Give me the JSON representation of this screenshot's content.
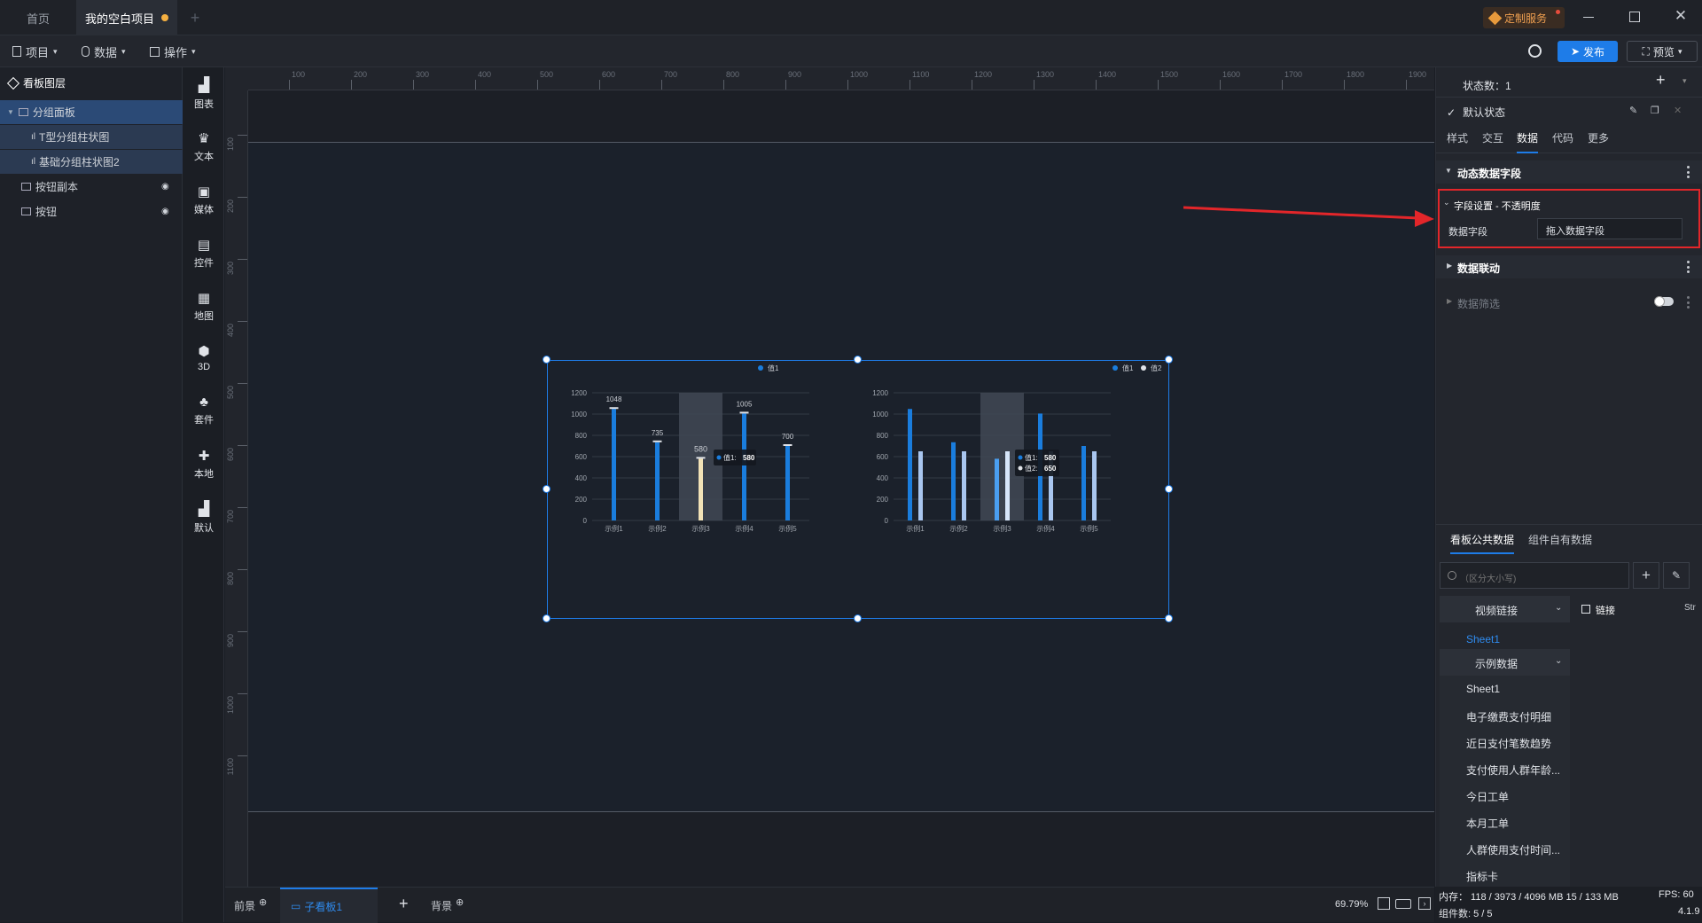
{
  "tabs": [
    {
      "label": "首页"
    },
    {
      "label": "我的空白项目"
    }
  ],
  "titlebar": {
    "custom_service": "定制服务"
  },
  "menubar": {
    "project": "项目",
    "data": "数据",
    "ops": "操作",
    "publish": "发布",
    "preview": "预览"
  },
  "layers": {
    "title": "看板图层",
    "items": [
      {
        "label": "分组面板"
      },
      {
        "label": "T型分组柱状图"
      },
      {
        "label": "基础分组柱状图2"
      },
      {
        "label": "按钮副本"
      },
      {
        "label": "按钮"
      }
    ]
  },
  "toolbox": [
    {
      "label": "图表",
      "icon": "chart-icon"
    },
    {
      "label": "文本",
      "icon": "text-icon"
    },
    {
      "label": "媒体",
      "icon": "media-icon"
    },
    {
      "label": "控件",
      "icon": "control-icon"
    },
    {
      "label": "地图",
      "icon": "map-icon"
    },
    {
      "label": "3D",
      "icon": "cube-icon"
    },
    {
      "label": "套件",
      "icon": "kit-icon"
    },
    {
      "label": "本地",
      "icon": "puzzle-icon"
    },
    {
      "label": "默认",
      "icon": "default-chart-icon"
    }
  ],
  "ruler": {
    "top_ticks": [
      "100",
      "200",
      "300",
      "400",
      "500",
      "600",
      "700",
      "800",
      "900",
      "1000",
      "1100",
      "1200",
      "1300",
      "1400",
      "1500",
      "1600",
      "1700",
      "1800",
      "1900"
    ],
    "left_ticks": [
      "100",
      "200",
      "300",
      "400",
      "500",
      "600",
      "700",
      "800",
      "900",
      "1000",
      "1100"
    ]
  },
  "bottom": {
    "foreground": "前景",
    "subboard": "子看板1",
    "background": "背景",
    "zoom": "69.79%"
  },
  "right": {
    "state_count_label": "状态数：1",
    "default_state": "默认状态",
    "tabs": [
      "样式",
      "交互",
      "数据",
      "代码",
      "更多"
    ],
    "dynamic_fields": "动态数据字段",
    "field_setting": "字段设置 - 不透明度",
    "data_field_label": "数据字段",
    "data_field_placeholder": "拖入数据字段",
    "data_link": "数据联动",
    "data_filter": "数据筛选",
    "data_tabs": [
      "看板公共数据",
      "组件自有数据"
    ],
    "search_placeholder": "（区分大小写)",
    "video_link": "视频链接",
    "link_label": "链接",
    "str_label": "Str",
    "sheet_active": "Sheet1",
    "example_data": "示例数据",
    "sheets": [
      "Sheet1",
      "电子缴费支付明细",
      "近日支付笔数趋势",
      "支付使用人群年龄...",
      "今日工单",
      "本月工单",
      "人群使用支付时间...",
      "指标卡"
    ]
  },
  "status": {
    "memory": "内存： 118 / 3973 / 4096 MB  15 / 133 MB",
    "fps": "FPS:  60",
    "components": "组件数: 5 / 5",
    "version": "4.1.9"
  },
  "colors": {
    "accent": "#1e7ce8",
    "bar1": "#1a7ddd",
    "bar2": "#a9c6ef",
    "highlight": "#f3e3b7",
    "highlight_bar2": "#4a9ef0"
  },
  "chart_data": [
    {
      "type": "bar",
      "categories": [
        "示例1",
        "示例2",
        "示例3",
        "示例4",
        "示例5"
      ],
      "series": [
        {
          "name": "值1",
          "values": [
            1048,
            735,
            580,
            1005,
            700
          ]
        }
      ],
      "ylim": [
        0,
        1200
      ],
      "yticks": [
        "0",
        "200",
        "400",
        "600",
        "800",
        "1000",
        "1200"
      ],
      "data_labels": [
        "1048",
        "735",
        "580",
        "1005",
        "700"
      ],
      "highlight_index": 2,
      "tooltip": {
        "label": "值1:",
        "value": "580"
      },
      "legend": "top-center",
      "grid": true
    },
    {
      "type": "bar",
      "categories": [
        "示例1",
        "示例2",
        "示例3",
        "示例4",
        "示例5"
      ],
      "series": [
        {
          "name": "值1",
          "values": [
            1048,
            735,
            580,
            1005,
            700
          ]
        },
        {
          "name": "值2",
          "values": [
            650,
            650,
            650,
            650,
            650
          ]
        }
      ],
      "ylim": [
        0,
        1200
      ],
      "yticks": [
        "0",
        "200",
        "400",
        "600",
        "800",
        "1000",
        "1200"
      ],
      "highlight_index": 2,
      "tooltip": {
        "rows": [
          {
            "label": "值1:",
            "value": "580"
          },
          {
            "label": "值2:",
            "value": "650"
          }
        ]
      },
      "legend": "top-right",
      "grid": true
    }
  ]
}
